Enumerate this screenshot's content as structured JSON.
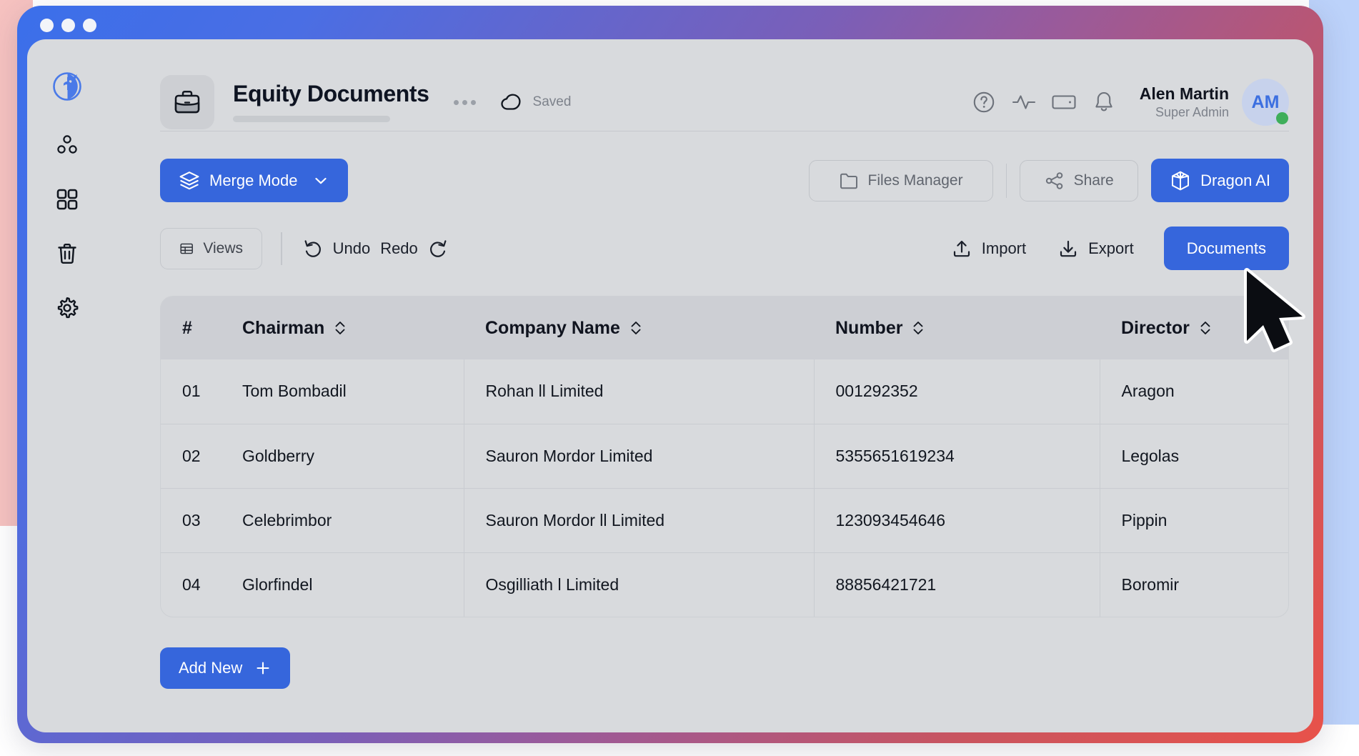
{
  "window": {
    "traffic_lights": [
      "close",
      "minimize",
      "maximize"
    ]
  },
  "sidebar": {
    "logo": "dragon-logo-icon",
    "items": [
      {
        "name": "nodes",
        "icon": "nodes-cluster-icon"
      },
      {
        "name": "grid",
        "icon": "grid-apps-icon"
      },
      {
        "name": "trash",
        "icon": "trash-icon"
      },
      {
        "name": "settings",
        "icon": "gear-icon"
      }
    ]
  },
  "header": {
    "doc_icon": "briefcase-icon",
    "title": "Equity Documents",
    "more_menu": "more-options",
    "save_status": "Saved",
    "save_icon": "cloud-icon",
    "icons": [
      {
        "name": "help",
        "icon": "question-circle-icon"
      },
      {
        "name": "activity",
        "icon": "pulse-icon"
      },
      {
        "name": "billing",
        "icon": "card-icon"
      },
      {
        "name": "notifications",
        "icon": "bell-icon"
      }
    ],
    "user": {
      "name": "Alen Martin",
      "role": "Super Admin",
      "initials": "AM",
      "status": "online"
    }
  },
  "toolbar": {
    "merge_mode": "Merge Mode",
    "files_manager": "Files Manager",
    "share": "Share",
    "dragon_ai": "Dragon AI",
    "views": "Views",
    "undo": "Undo",
    "redo": "Redo",
    "import": "Import",
    "export": "Export",
    "documents": "Documents"
  },
  "table": {
    "columns": [
      {
        "key": "index",
        "label": "#",
        "sortable": false
      },
      {
        "key": "chairman",
        "label": "Chairman",
        "sortable": true
      },
      {
        "key": "company",
        "label": "Company Name",
        "sortable": true
      },
      {
        "key": "number",
        "label": "Number",
        "sortable": true
      },
      {
        "key": "director",
        "label": "Director",
        "sortable": true
      }
    ],
    "rows": [
      {
        "index": "01",
        "chairman": "Tom Bombadil",
        "company": "Rohan ll Limited",
        "number": "001292352",
        "director": "Aragon"
      },
      {
        "index": "02",
        "chairman": "Goldberry",
        "company": "Sauron Mordor Limited",
        "number": "5355651619234",
        "director": "Legolas"
      },
      {
        "index": "03",
        "chairman": "Celebrimbor",
        "company": "Sauron Mordor ll Limited",
        "number": "123093454646",
        "director": "Pippin"
      },
      {
        "index": "04",
        "chairman": "Glorfindel",
        "company": "Osgilliath l Limited",
        "number": "88856421721",
        "director": "Boromir"
      }
    ]
  },
  "footer": {
    "add_new": "Add New"
  },
  "colors": {
    "accent_blue": "#3666dc",
    "surface": "#d8dadd",
    "header_row": "#cdcfd4",
    "text_primary": "#10141f",
    "text_muted": "#7d828b",
    "status_online": "#3fae5a",
    "frame_gradient_start": "#3b6fea",
    "frame_gradient_mid": "#9a5a9a",
    "frame_gradient_end": "#e8524a"
  }
}
